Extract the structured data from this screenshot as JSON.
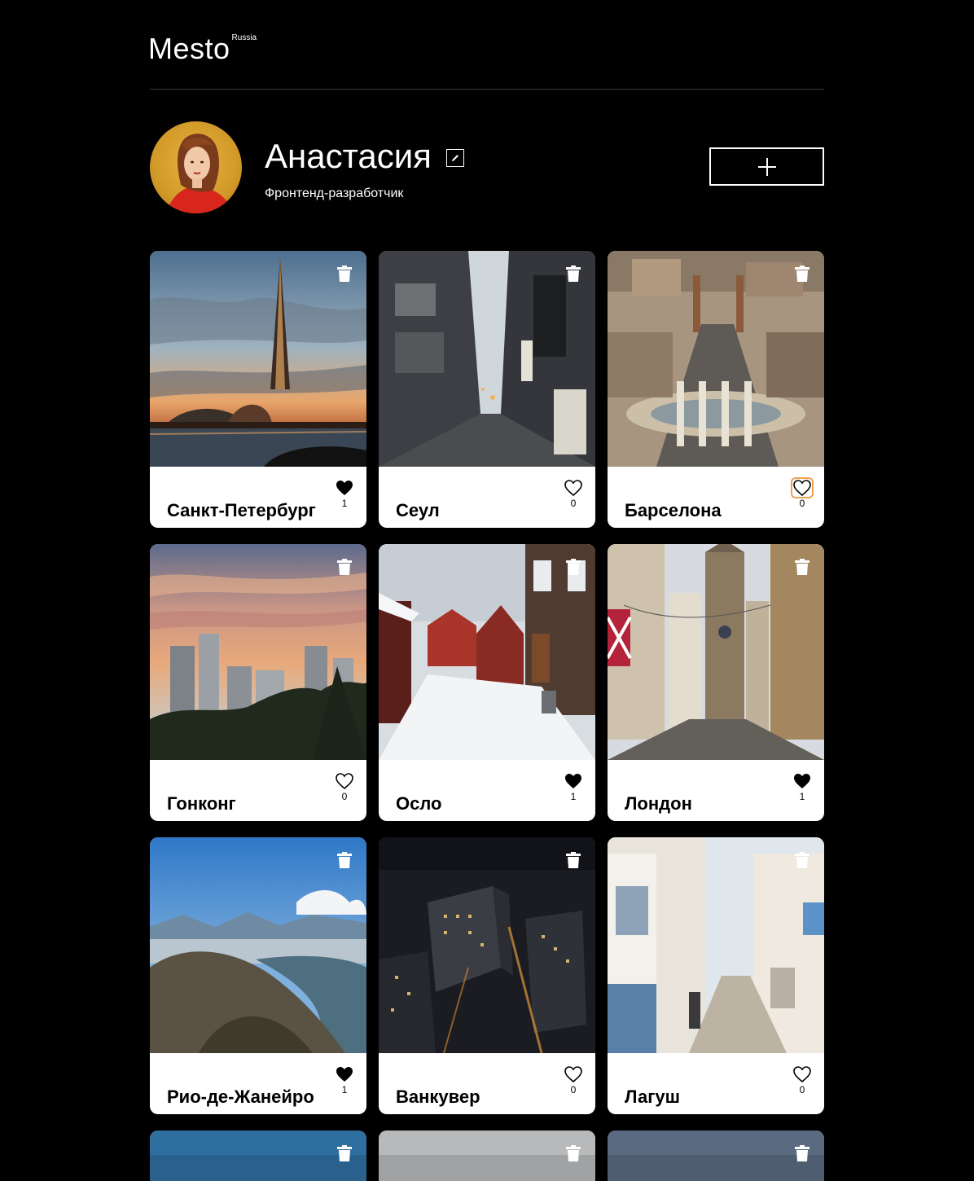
{
  "header": {
    "logo_text": "Mesto",
    "logo_sup": "Russia"
  },
  "profile": {
    "name": "Анастасия",
    "about": "Фронтенд-разработчик",
    "edit_icon": "pencil-edit-icon",
    "add_icon": "plus-icon"
  },
  "cards": [
    {
      "title": "Санкт-Петербург",
      "likes": "1",
      "liked": true,
      "scene": "tower-sunset"
    },
    {
      "title": "Сеул",
      "likes": "0",
      "liked": false,
      "scene": "alley"
    },
    {
      "title": "Барселона",
      "likes": "0",
      "liked": false,
      "hover": true,
      "scene": "plaza"
    },
    {
      "title": "Гонконг",
      "likes": "0",
      "liked": false,
      "scene": "skyline-sunset"
    },
    {
      "title": "Осло",
      "likes": "1",
      "liked": true,
      "scene": "snow-street"
    },
    {
      "title": "Лондон",
      "likes": "1",
      "liked": true,
      "scene": "old-street"
    },
    {
      "title": "Рио-де-Жанейро",
      "likes": "1",
      "liked": true,
      "scene": "mountain-bay"
    },
    {
      "title": "Ванкувер",
      "likes": "0",
      "liked": false,
      "scene": "night-city"
    },
    {
      "title": "Лагуш",
      "likes": "0",
      "liked": false,
      "scene": "white-street"
    }
  ],
  "colors": {
    "background": "#000000",
    "card": "#ffffff",
    "text_dark": "#000000",
    "hover_accent": "#f0a050"
  }
}
